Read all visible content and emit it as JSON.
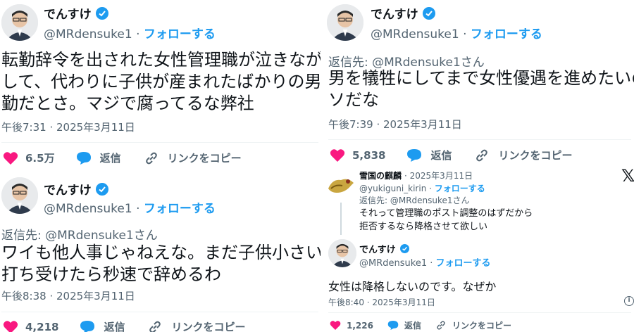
{
  "tweets": [
    {
      "name": "でんすけ",
      "handle": "@MRdensuke1",
      "separator": "·",
      "follow": "フォローする",
      "lines": [
        "転勤辞令を出された女性管理職が泣きながら",
        "して、代わりに子供が産まれたばかりの男性",
        "勤だとさ。マジで腐ってるな弊社"
      ],
      "time": "午後7:31 · 2025年3月11日",
      "likes": "6.5万",
      "reply_label": "返信",
      "copy_label": "リンクをコピー"
    },
    {
      "name": "でんすけ",
      "handle": "@MRdensuke1",
      "separator": "·",
      "follow": "フォローする",
      "reply_to": "返信先: @MRdensuke1さん",
      "lines": [
        "ワイも他人事じゃねえな。まだ子供小さいし",
        "打ち受けたら秒速で辞めるわ"
      ],
      "time": "午後8:38 · 2025年3月11日",
      "likes": "4,218",
      "reply_label": "返信",
      "copy_label": "リンクをコピー"
    },
    {
      "name": "でんすけ",
      "handle": "@MRdensuke1",
      "separator": "·",
      "follow": "フォローする",
      "reply_to": "返信先: @MRdensuke1さん",
      "lines": [
        "男を犠牲にしてまで女性優遇を進めたいの",
        "ソだな"
      ],
      "time": "午後7:39 · 2025年3月11日",
      "likes": "5,838",
      "reply_label": "返信",
      "copy_label": "リンクをコピー"
    },
    {
      "quoted": {
        "name": "雪国の麒麟",
        "date": "· 2025年3月11日",
        "handle": "@yukiguni_kirin",
        "separator": "·",
        "follow": "フォローする",
        "reply_to": "返信先: @MRdensuke1さん",
        "lines": [
          "それって管理職のポスト調整のはずだから",
          "拒否するなら降格させて欲しい"
        ]
      },
      "name": "でんすけ",
      "handle": "@MRdensuke1",
      "separator": "·",
      "follow": "フォローする",
      "lines": [
        "女性は降格しないのです。なぜか"
      ],
      "time": "午後8:40 · 2025年3月11日",
      "likes": "1,226",
      "reply_label": "返信",
      "copy_label": "リンクをコピー",
      "x_logo": "𝕏",
      "info": "i"
    }
  ],
  "colors": {
    "accent": "#1d9bf0",
    "like": "#f91880",
    "muted": "#536471",
    "text": "#0f1419"
  },
  "icons": [
    "verified-badge-icon",
    "heart-icon",
    "reply-bubble-icon",
    "link-icon",
    "x-logo-icon",
    "info-icon"
  ]
}
